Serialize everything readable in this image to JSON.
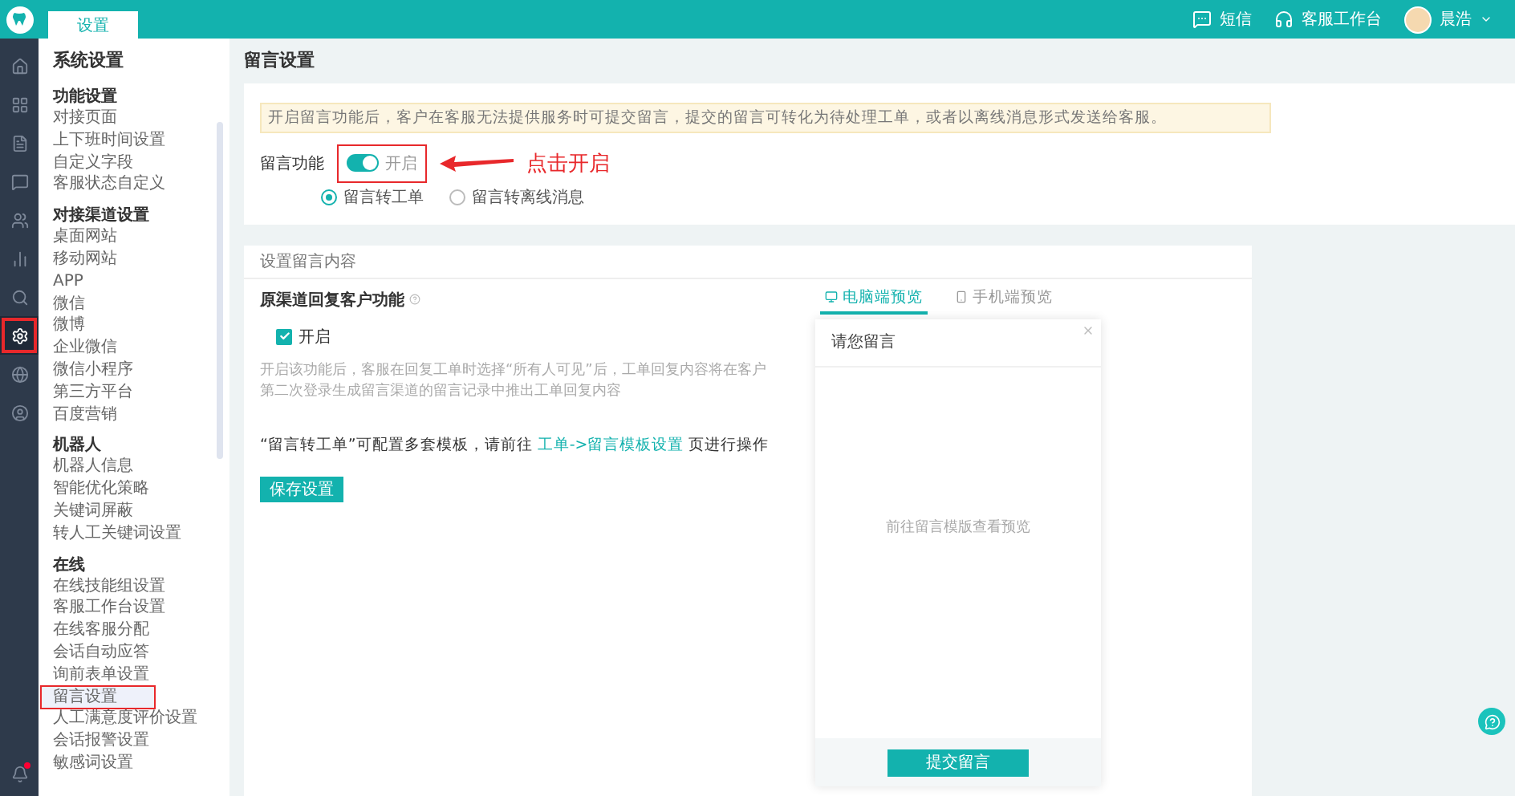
{
  "topbar": {
    "tabs": [
      {
        "label": "设置",
        "selected": true
      }
    ],
    "actions": [
      {
        "kind": "sms",
        "label": "短信"
      },
      {
        "kind": "workbench",
        "label": "客服工作台"
      },
      {
        "kind": "user",
        "label": "晨浩"
      }
    ]
  },
  "rail": [
    {
      "kind": "home",
      "selected": false,
      "highlighted": false
    },
    {
      "kind": "grid",
      "selected": false,
      "highlighted": false
    },
    {
      "kind": "file",
      "selected": false,
      "highlighted": false
    },
    {
      "kind": "chat",
      "selected": false,
      "highlighted": false
    },
    {
      "kind": "users",
      "selected": false,
      "highlighted": false
    },
    {
      "kind": "chart",
      "selected": false,
      "highlighted": false
    },
    {
      "kind": "search",
      "selected": false,
      "highlighted": false
    },
    {
      "kind": "settings",
      "selected": true,
      "highlighted": true
    },
    {
      "kind": "globe",
      "selected": false,
      "highlighted": false
    },
    {
      "kind": "account",
      "selected": false,
      "highlighted": false
    }
  ],
  "rail_bell": {
    "badge": true
  },
  "sidebar": {
    "title": "系统设置",
    "sections": [
      {
        "title": "功能设置",
        "items": [
          {
            "label": "对接页面",
            "selected": false,
            "highlighted": false
          },
          {
            "label": "上下班时间设置",
            "selected": false,
            "highlighted": false
          },
          {
            "label": "自定义字段",
            "selected": false,
            "highlighted": false
          },
          {
            "label": "客服状态自定义",
            "selected": false,
            "highlighted": false
          }
        ]
      },
      {
        "title": "对接渠道设置",
        "items": [
          {
            "label": "桌面网站",
            "selected": false,
            "highlighted": false
          },
          {
            "label": "移动网站",
            "selected": false,
            "highlighted": false
          },
          {
            "label": "APP",
            "selected": false,
            "highlighted": false
          },
          {
            "label": "微信",
            "selected": false,
            "highlighted": false
          },
          {
            "label": "微博",
            "selected": false,
            "highlighted": false
          },
          {
            "label": "企业微信",
            "selected": false,
            "highlighted": false
          },
          {
            "label": "微信小程序",
            "selected": false,
            "highlighted": false
          },
          {
            "label": "第三方平台",
            "selected": false,
            "highlighted": false
          },
          {
            "label": "百度营销",
            "selected": false,
            "highlighted": false
          }
        ]
      },
      {
        "title": "机器人",
        "items": [
          {
            "label": "机器人信息",
            "selected": false,
            "highlighted": false
          },
          {
            "label": "智能优化策略",
            "selected": false,
            "highlighted": false
          },
          {
            "label": "关键词屏蔽",
            "selected": false,
            "highlighted": false
          },
          {
            "label": "转人工关键词设置",
            "selected": false,
            "highlighted": false
          }
        ]
      },
      {
        "title": "在线",
        "items": [
          {
            "label": "在线技能组设置",
            "selected": false,
            "highlighted": false
          },
          {
            "label": "客服工作台设置",
            "selected": false,
            "highlighted": false
          },
          {
            "label": "在线客服分配",
            "selected": false,
            "highlighted": false
          },
          {
            "label": "会话自动应答",
            "selected": false,
            "highlighted": false
          },
          {
            "label": "询前表单设置",
            "selected": false,
            "highlighted": false
          },
          {
            "label": "留言设置",
            "selected": true,
            "highlighted": true
          },
          {
            "label": "人工满意度评价设置",
            "selected": false,
            "highlighted": false
          },
          {
            "label": "会话报警设置",
            "selected": false,
            "highlighted": false
          },
          {
            "label": "敏感词设置",
            "selected": false,
            "highlighted": false
          }
        ]
      }
    ]
  },
  "page_title": "留言设置",
  "notice": "开启留言功能后，客户在客服无法提供服务时可提交留言，提交的留言可转化为待处理工单，或者以离线消息形式发送给客服。",
  "feature": {
    "label": "留言功能",
    "on": true,
    "state_label": "开启",
    "highlighted": true,
    "callout": "点击开启",
    "options": [
      {
        "label": "留言转工单",
        "selected": true
      },
      {
        "label": "留言转离线消息",
        "selected": false
      }
    ]
  },
  "content": {
    "title": "设置留言内容",
    "reply_title": "原渠道回复客户功能",
    "reply_checkbox": {
      "label": "开启",
      "checked": true
    },
    "description": "开启该功能后，客服在回复工单时选择“所有人可见”后，工单回复内容将在客户第二次登录生成留言渠道的留言记录中推出工单回复内容",
    "template_text_before": "“留言转工单”可配置多套模板，请前往",
    "template_link": "工单->留言模板设置",
    "template_text_after": "页进行操作",
    "save_button": "保存设置"
  },
  "preview": {
    "tabs": [
      {
        "kind": "desktop",
        "label": "电脑端预览",
        "selected": true
      },
      {
        "kind": "mobile",
        "label": "手机端预览",
        "selected": false
      }
    ],
    "dialog_title": "请您留言",
    "hint": "前往留言模版查看预览",
    "submit": "提交留言"
  }
}
